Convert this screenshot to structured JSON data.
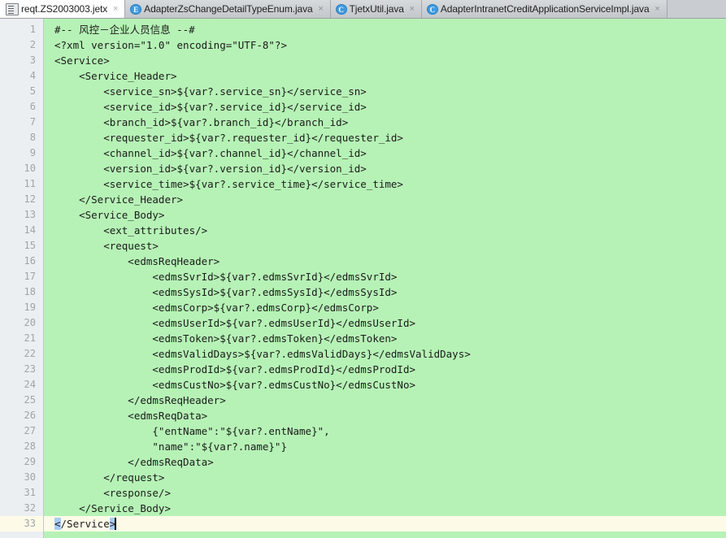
{
  "window": {
    "title": "reqt.ZS2003003.jetx"
  },
  "tabs": [
    {
      "label": "reqt.ZS2003003.jetx",
      "icon": "file-icon",
      "icon_letter": "",
      "active": true,
      "close_label": "×"
    },
    {
      "label": "AdapterZsChangeDetailTypeEnum.java",
      "icon": "enum-class-icon",
      "icon_letter": "E",
      "active": false,
      "close_label": "×"
    },
    {
      "label": "TjetxUtil.java",
      "icon": "java-class-icon",
      "icon_letter": "C",
      "active": false,
      "close_label": "×"
    },
    {
      "label": "AdapterIntranetCreditApplicationServiceImpl.java",
      "icon": "java-class-icon",
      "icon_letter": "C",
      "active": false,
      "close_label": "×"
    }
  ],
  "editor": {
    "caret_line_number": 33,
    "colors": {
      "code_background": "#b6f2b6",
      "caret_line_background": "#fdfbe8",
      "selection": "#a8cdf0",
      "gutter_background": "#eceff1",
      "line_number": "#a0a4a8",
      "text": "#1b1b1b",
      "tabbar_background": "#c9cdd1",
      "active_tab_background": "#ffffff",
      "icon_blue": "#3d9ae0"
    },
    "lines": [
      {
        "n": 1,
        "text": "#-- 风控－企业人员信息 --#"
      },
      {
        "n": 2,
        "text": "<?xml version=\"1.0\" encoding=\"UTF-8\"?>"
      },
      {
        "n": 3,
        "text": "<Service>"
      },
      {
        "n": 4,
        "text": "    <Service_Header>"
      },
      {
        "n": 5,
        "text": "        <service_sn>${var?.service_sn}</service_sn>"
      },
      {
        "n": 6,
        "text": "        <service_id>${var?.service_id}</service_id>"
      },
      {
        "n": 7,
        "text": "        <branch_id>${var?.branch_id}</branch_id>"
      },
      {
        "n": 8,
        "text": "        <requester_id>${var?.requester_id}</requester_id>"
      },
      {
        "n": 9,
        "text": "        <channel_id>${var?.channel_id}</channel_id>"
      },
      {
        "n": 10,
        "text": "        <version_id>${var?.version_id}</version_id>"
      },
      {
        "n": 11,
        "text": "        <service_time>${var?.service_time}</service_time>"
      },
      {
        "n": 12,
        "text": "    </Service_Header>"
      },
      {
        "n": 13,
        "text": "    <Service_Body>"
      },
      {
        "n": 14,
        "text": "        <ext_attributes/>"
      },
      {
        "n": 15,
        "text": "        <request>"
      },
      {
        "n": 16,
        "text": "            <edmsReqHeader>"
      },
      {
        "n": 17,
        "text": "                <edmsSvrId>${var?.edmsSvrId}</edmsSvrId>"
      },
      {
        "n": 18,
        "text": "                <edmsSysId>${var?.edmsSysId}</edmsSysId>"
      },
      {
        "n": 19,
        "text": "                <edmsCorp>${var?.edmsCorp}</edmsCorp>"
      },
      {
        "n": 20,
        "text": "                <edmsUserId>${var?.edmsUserId}</edmsUserId>"
      },
      {
        "n": 21,
        "text": "                <edmsToken>${var?.edmsToken}</edmsToken>"
      },
      {
        "n": 22,
        "text": "                <edmsValidDays>${var?.edmsValidDays}</edmsValidDays>"
      },
      {
        "n": 23,
        "text": "                <edmsProdId>${var?.edmsProdId}</edmsProdId>"
      },
      {
        "n": 24,
        "text": "                <edmsCustNo>${var?.edmsCustNo}</edmsCustNo>"
      },
      {
        "n": 25,
        "text": "            </edmsReqHeader>"
      },
      {
        "n": 26,
        "text": "            <edmsReqData>"
      },
      {
        "n": 27,
        "text": "                {\"entName\":\"${var?.entName}\","
      },
      {
        "n": 28,
        "text": "                \"name\":\"${var?.name}\"}"
      },
      {
        "n": 29,
        "text": "            </edmsReqData>"
      },
      {
        "n": 30,
        "text": "        </request>"
      },
      {
        "n": 31,
        "text": "        <response/>"
      },
      {
        "n": 32,
        "text": "    </Service_Body>"
      },
      {
        "n": 33,
        "text": "</Service>",
        "caret": true,
        "selection": [
          [
            0,
            1
          ],
          [
            9,
            10
          ]
        ]
      }
    ]
  }
}
